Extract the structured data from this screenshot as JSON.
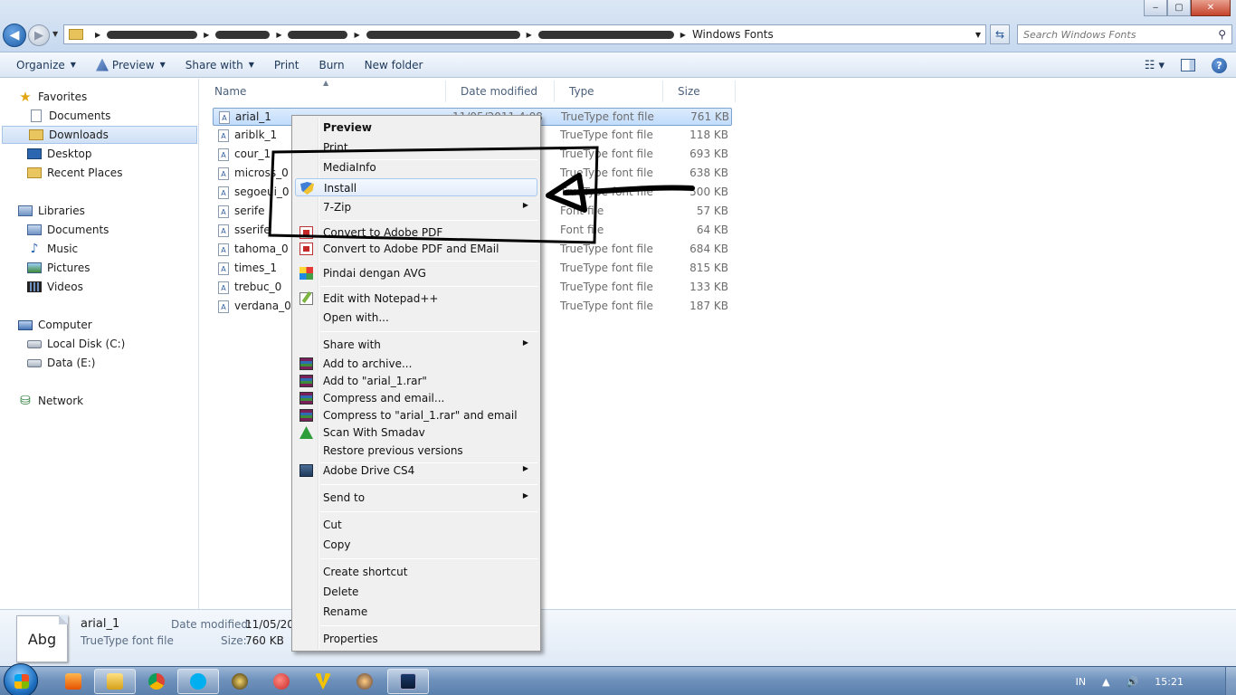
{
  "window": {
    "breadcrumb_last": "Windows Fonts",
    "search_placeholder": "Search Windows Fonts",
    "btn_min": "‒",
    "btn_max": "▢",
    "btn_close": "✕"
  },
  "toolbar": {
    "organize": "Organize",
    "preview": "Preview",
    "share_with": "Share with",
    "print": "Print",
    "burn": "Burn",
    "new_folder": "New folder",
    "help": "?"
  },
  "nav": {
    "favorites": "Favorites",
    "documents": "Documents",
    "downloads": "Downloads",
    "desktop": "Desktop",
    "recent_places": "Recent Places",
    "libraries": "Libraries",
    "lib_documents": "Documents",
    "music": "Music",
    "pictures": "Pictures",
    "videos": "Videos",
    "computer": "Computer",
    "local_disk": "Local Disk (C:)",
    "data_drive": "Data (E:)",
    "network": "Network"
  },
  "columns": {
    "name": "Name",
    "date_modified": "Date modified",
    "type": "Type",
    "size": "Size"
  },
  "files": [
    {
      "name": "arial_1",
      "date": "11/05/2011 4:08",
      "type": "TrueType font file",
      "size": "761 KB"
    },
    {
      "name": "ariblk_1",
      "date": "",
      "type": "TrueType font file",
      "size": "118 KB"
    },
    {
      "name": "cour_1",
      "date": "",
      "type": "TrueType font file",
      "size": "693 KB"
    },
    {
      "name": "micross_0",
      "date": "",
      "type": "TrueType font file",
      "size": "638 KB"
    },
    {
      "name": "segoeui_0",
      "date": "",
      "type": "TrueType font file",
      "size": "500 KB"
    },
    {
      "name": "serife",
      "date": "",
      "type": "Font file",
      "size": "57 KB"
    },
    {
      "name": "sserife",
      "date": "",
      "type": "Font file",
      "size": "64 KB"
    },
    {
      "name": "tahoma_0",
      "date": "",
      "type": "TrueType font file",
      "size": "684 KB"
    },
    {
      "name": "times_1",
      "date": "",
      "type": "TrueType font file",
      "size": "815 KB"
    },
    {
      "name": "trebuc_0",
      "date": "",
      "type": "TrueType font file",
      "size": "133 KB"
    },
    {
      "name": "verdana_0",
      "date": "",
      "type": "TrueType font file",
      "size": "187 KB"
    }
  ],
  "context_menu": {
    "preview": "Preview",
    "print": "Print",
    "mediainfo": "MediaInfo",
    "install": "Install",
    "seven_zip": "7-Zip",
    "convert_pdf": "Convert to Adobe PDF",
    "convert_pdf_email": "Convert to Adobe PDF and EMail",
    "pindai_avg": "Pindai dengan AVG",
    "edit_notepad": "Edit with Notepad++",
    "open_with": "Open with...",
    "share_with": "Share with",
    "add_archive": "Add to archive...",
    "add_rar": "Add to \"arial_1.rar\"",
    "compress_email": "Compress and email...",
    "compress_rar_email": "Compress to \"arial_1.rar\" and email",
    "scan_smadav": "Scan With Smadav",
    "restore_versions": "Restore previous versions",
    "adobe_drive": "Adobe Drive CS4",
    "send_to": "Send to",
    "cut": "Cut",
    "copy": "Copy",
    "create_shortcut": "Create shortcut",
    "delete": "Delete",
    "rename": "Rename",
    "properties": "Properties"
  },
  "details": {
    "thumb_text": "Abg",
    "name": "arial_1",
    "type": "TrueType font file",
    "date_label": "Date modified:",
    "date_value": "11/05/201",
    "size_label": "Size:",
    "size_value": "760 KB"
  },
  "taskbar": {
    "language": "IN",
    "clock": "15:21"
  }
}
